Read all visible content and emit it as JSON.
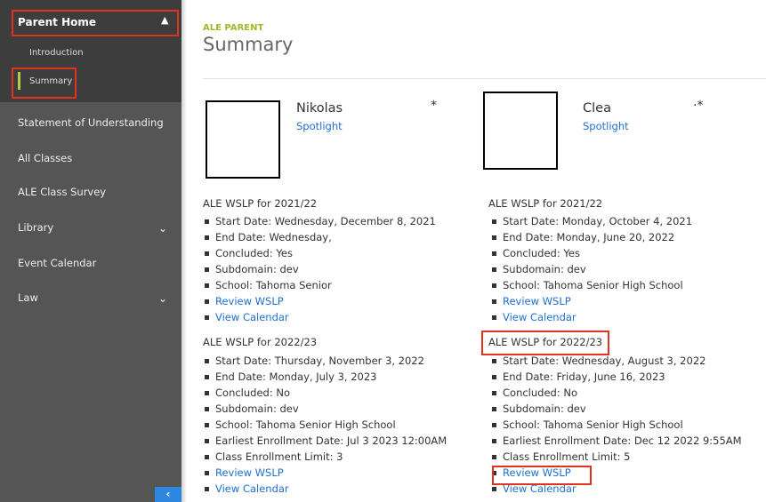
{
  "sidebar": {
    "group_title": "Parent Home",
    "sub_items": [
      "Introduction",
      "Summary"
    ],
    "items": [
      {
        "label": "Statement of Understanding",
        "expandable": false
      },
      {
        "label": "All Classes",
        "expandable": false
      },
      {
        "label": "ALE Class Survey",
        "expandable": false
      },
      {
        "label": "Library",
        "expandable": true
      },
      {
        "label": "Event Calendar",
        "expandable": false
      },
      {
        "label": "Law",
        "expandable": true
      }
    ],
    "collapse_icon": "chevron-left-icon"
  },
  "header": {
    "breadcrumb": "ALE PARENT",
    "title": "Summary"
  },
  "students": [
    {
      "name": "Nikolas",
      "marker": "*",
      "spotlight": "Spotlight",
      "wslp": [
        {
          "heading": "ALE WSLP for 2021/22",
          "items": [
            "Start Date: Wednesday, December 8, 2021",
            "End Date: Wednesday,",
            "Concluded: Yes",
            "Subdomain: dev",
            "School: Tahoma Senior"
          ],
          "links": [
            "Review WSLP",
            "View Calendar"
          ]
        },
        {
          "heading": "ALE WSLP for 2022/23",
          "items": [
            "Start Date: Thursday, November 3, 2022",
            "End Date: Monday, July 3, 2023",
            "Concluded: No",
            "Subdomain: dev",
            "School: Tahoma Senior High School",
            "Earliest Enrollment Date: Jul 3 2023 12:00AM",
            "Class Enrollment Limit: 3"
          ],
          "links": [
            "Review WSLP",
            "View Calendar"
          ]
        }
      ]
    },
    {
      "name": "Clea",
      "marker": "·*",
      "spotlight": "Spotlight",
      "wslp": [
        {
          "heading": "ALE WSLP for 2021/22",
          "items": [
            "Start Date: Monday, October 4, 2021",
            "End Date: Monday, June 20, 2022",
            "Concluded: Yes",
            "Subdomain: dev",
            "School: Tahoma Senior High School"
          ],
          "links": [
            "Review WSLP",
            "View Calendar"
          ]
        },
        {
          "heading": "ALE WSLP for 2022/23",
          "items": [
            "Start Date: Wednesday, August 3, 2022",
            "End Date: Friday, June 16, 2023",
            "Concluded: No",
            "Subdomain: dev",
            "School: Tahoma Senior High School",
            "Earliest Enrollment Date: Dec 12 2022 9:55AM",
            "Class Enrollment Limit: 5"
          ],
          "links": [
            "Review WSLP",
            "View Calendar"
          ]
        }
      ]
    }
  ],
  "colors": {
    "sidebar": "#555555",
    "sidebar_group": "#3d3d3d",
    "accent": "#a6b628",
    "link": "#1f6fd0",
    "highlight": "#e0321f"
  }
}
